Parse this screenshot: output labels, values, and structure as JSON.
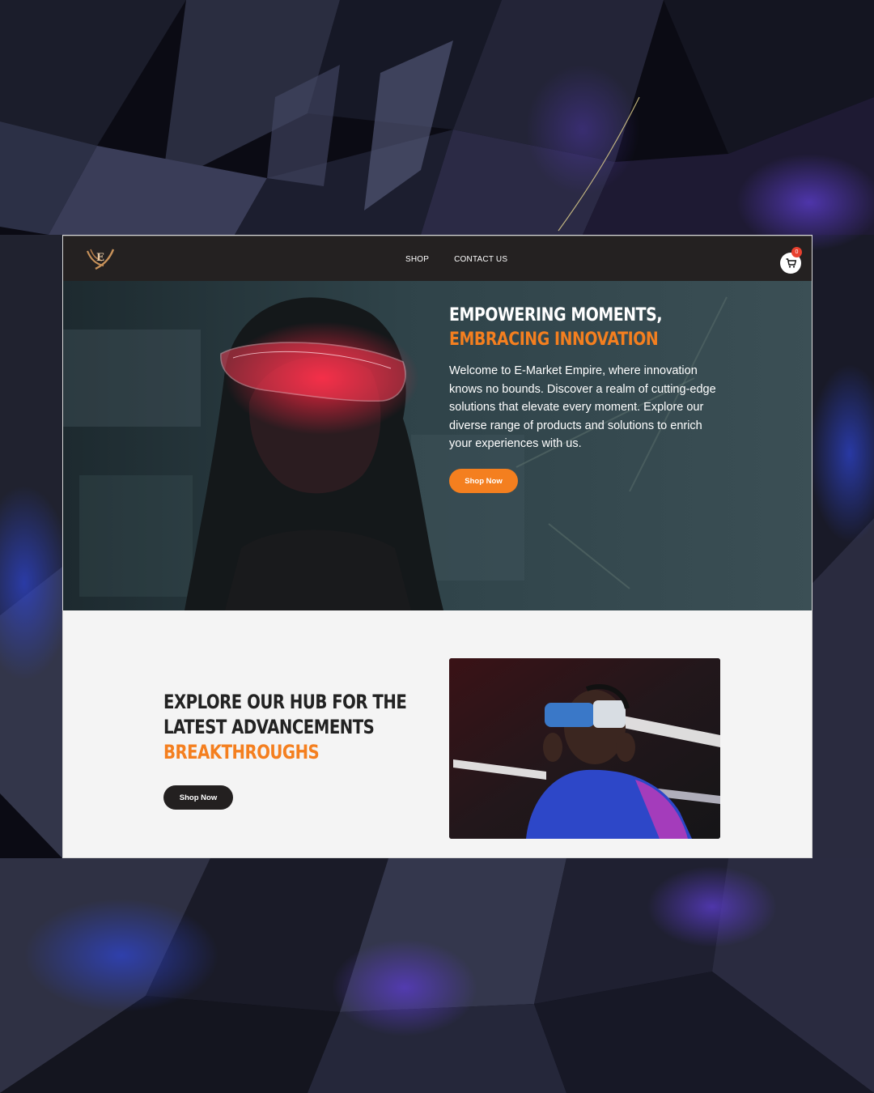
{
  "nav": {
    "links": [
      "SHOP",
      "CONTACT US"
    ],
    "cart_count": "0"
  },
  "hero": {
    "title_line1": "EMPOWERING MOMENTS,",
    "title_line2": "EMBRACING INNOVATION",
    "description": "Welcome to E-Market Empire, where innovation knows no bounds. Discover a realm of cutting-edge solutions that elevate every moment. Explore our diverse range of products and solutions to enrich your experiences with us.",
    "button_label": "Shop Now"
  },
  "section2": {
    "title_line1": "EXPLORE OUR HUB FOR THE",
    "title_line2": "LATEST ADVANCEMENTS",
    "title_line3": "BREAKTHROUGHS",
    "button_label": "Shop Now"
  },
  "icons": {
    "logo": "e-wing-logo-icon",
    "cart": "cart-icon"
  },
  "colors": {
    "accent": "#f47f1f",
    "navbar": "#242121",
    "badge": "#e8412f",
    "dark_button": "#232020"
  }
}
